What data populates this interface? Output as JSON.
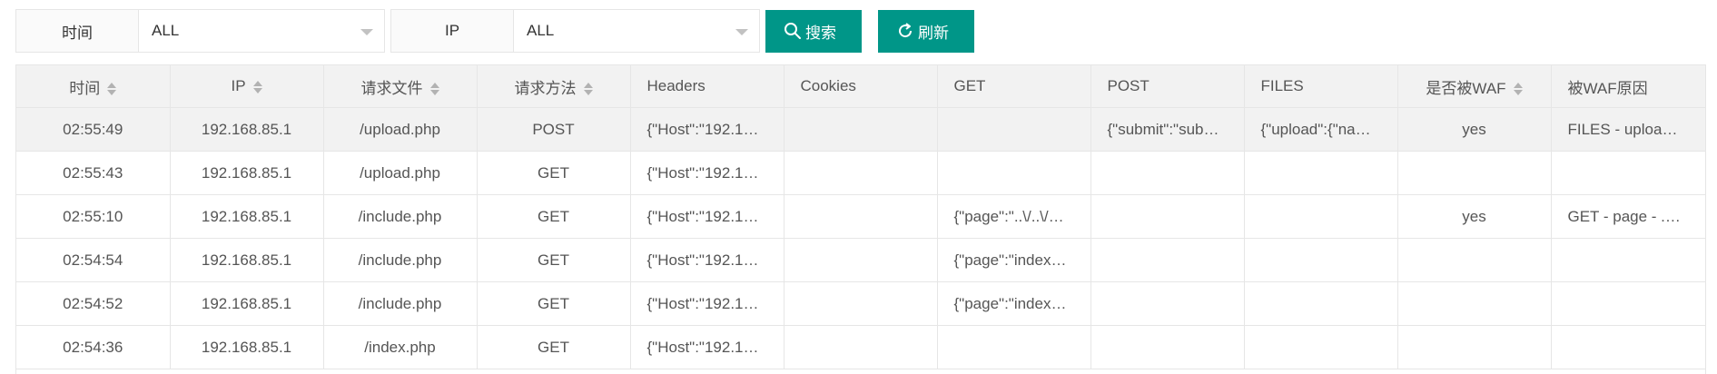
{
  "filters": {
    "time": {
      "label": "时间",
      "value": "ALL"
    },
    "ip": {
      "label": "IP",
      "value": "ALL"
    }
  },
  "buttons": {
    "search_label": "搜索",
    "refresh_label": "刷新",
    "search_icon": "search-icon",
    "refresh_icon": "refresh-icon"
  },
  "colors": {
    "accent": "#009688",
    "header_bg": "#f2f2f2",
    "highlight_row_bg": "#f2f2f2",
    "border": "#e6e6e6"
  },
  "table": {
    "columns": [
      "时间",
      "IP",
      "请求文件",
      "请求方法",
      "Headers",
      "Cookies",
      "GET",
      "POST",
      "FILES",
      "是否被WAF",
      "被WAF原因"
    ],
    "rows": [
      [
        "02:55:49",
        "192.168.85.1",
        "/upload.php",
        "POST",
        "{\"Host\":\"192.1…",
        "",
        "",
        "{\"submit\":\"sub…",
        "{\"upload\":{\"na…",
        "yes",
        "FILES - uploa…"
      ],
      [
        "02:55:43",
        "192.168.85.1",
        "/upload.php",
        "GET",
        "{\"Host\":\"192.1…",
        "",
        "",
        "",
        "",
        "",
        ""
      ],
      [
        "02:55:10",
        "192.168.85.1",
        "/include.php",
        "GET",
        "{\"Host\":\"192.1…",
        "",
        "{\"page\":\"..\\/..\\/…",
        "",
        "",
        "yes",
        "GET - page - .…"
      ],
      [
        "02:54:54",
        "192.168.85.1",
        "/include.php",
        "GET",
        "{\"Host\":\"192.1…",
        "",
        "{\"page\":\"index…",
        "",
        "",
        "",
        ""
      ],
      [
        "02:54:52",
        "192.168.85.1",
        "/include.php",
        "GET",
        "{\"Host\":\"192.1…",
        "",
        "{\"page\":\"index…",
        "",
        "",
        "",
        ""
      ],
      [
        "02:54:36",
        "192.168.85.1",
        "/index.php",
        "GET",
        "{\"Host\":\"192.1…",
        "",
        "",
        "",
        "",
        "",
        ""
      ]
    ]
  }
}
